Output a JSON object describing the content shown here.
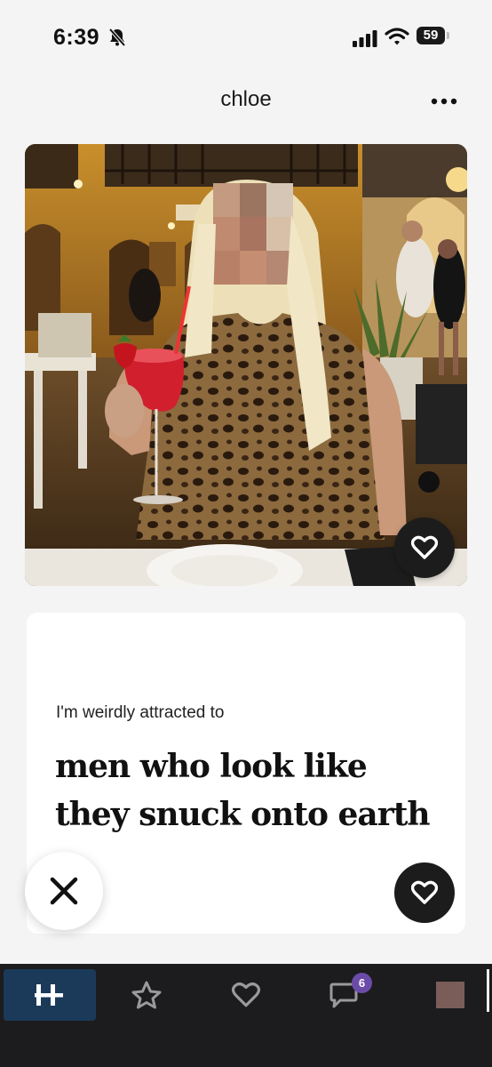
{
  "status_bar": {
    "time": "6:39",
    "battery": "59"
  },
  "header": {
    "profile_name": "chloe"
  },
  "prompt": {
    "question": "I'm weirdly attracted to",
    "answer": "men who look like they snuck onto earth"
  },
  "nav": {
    "matches_badge": "6"
  },
  "colors": {
    "dark_button": "#1c1c1c",
    "nav_background": "#1c1c1e",
    "nav_active": "#1b3a5a",
    "badge": "#6b4ba8"
  }
}
